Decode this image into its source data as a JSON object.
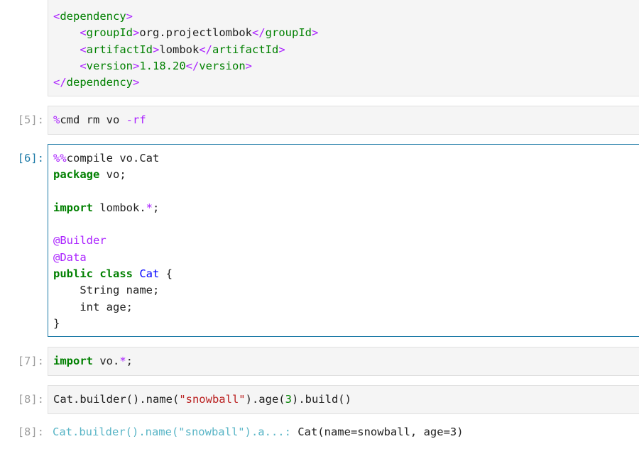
{
  "cells": {
    "dep": {
      "prompt": "",
      "lines": {
        "l1": {
          "open": "<",
          "name": "dependency",
          "close": ">"
        },
        "l2": {
          "indent": "    ",
          "open": "<",
          "name": "groupId",
          "close": ">",
          "value": "org.projectlombok",
          "endopen": "</",
          "endname": "groupId",
          "endclose": ">"
        },
        "l3": {
          "indent": "    ",
          "open": "<",
          "name": "artifactId",
          "close": ">",
          "value": "lombok",
          "endopen": "</",
          "endname": "artifactId",
          "endclose": ">"
        },
        "l4": {
          "indent": "    ",
          "open": "<",
          "name": "version",
          "close": ">",
          "value": "1.18.20",
          "endopen": "</",
          "endname": "version",
          "endclose": ">"
        },
        "l5": {
          "open": "</",
          "name": "dependency",
          "close": ">"
        }
      }
    },
    "c5": {
      "prompt": "[5]:",
      "magic": "%",
      "rest": "cmd rm vo ",
      "flag": "-rf"
    },
    "c6": {
      "prompt": "[6]:",
      "magic": "%%",
      "compile_rest": "compile vo.Cat",
      "pkg_kw": "package",
      "pkg_rest": " vo;",
      "imp_kw": "import",
      "imp_rest": " lombok.",
      "imp_star": "*",
      "imp_end": ";",
      "anno1": "@Builder",
      "anno2": "@Data",
      "pub_kw": "public class",
      "cls_name": "Cat",
      "brace_open": " {",
      "field1": "    String name;",
      "field2": "    int age;",
      "brace_close": "}"
    },
    "c7": {
      "prompt": "[7]:",
      "imp_kw": "import",
      "imp_rest": " vo.",
      "imp_star": "*",
      "imp_end": ";"
    },
    "c8": {
      "prompt": "[8]:",
      "code_a": "Cat.builder().name(",
      "code_str": "\"snowball\"",
      "code_b": ").age(",
      "code_num": "3",
      "code_c": ").build()"
    },
    "o8": {
      "prompt": "[8]:",
      "label": "Cat.builder().name(\"snowball\").a...:",
      "value": " Cat(name=snowball, age=3)"
    }
  }
}
